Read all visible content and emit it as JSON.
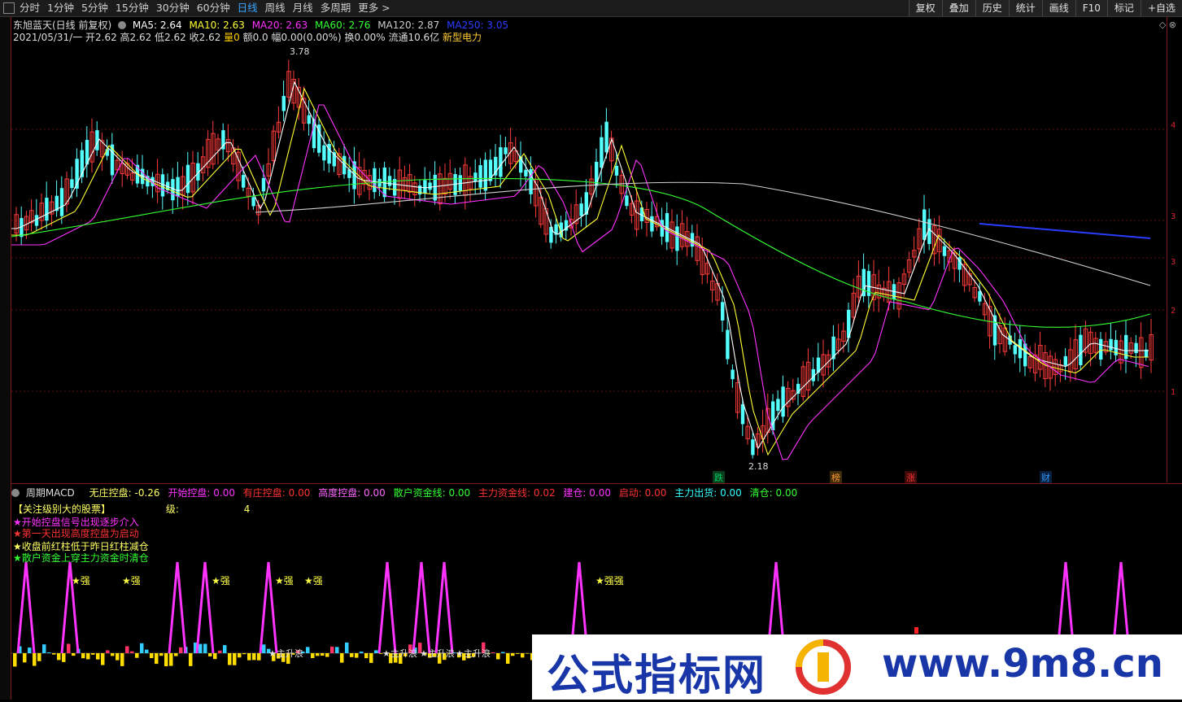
{
  "toolbar": {
    "periods": [
      "分时",
      "1分钟",
      "5分钟",
      "15分钟",
      "30分钟",
      "60分钟",
      "日线",
      "周线",
      "月线",
      "多周期",
      "更多 >"
    ],
    "active_period": "日线",
    "tools": [
      "复权",
      "叠加",
      "历史",
      "统计",
      "画线",
      "F10",
      "标记",
      "+自选"
    ]
  },
  "stock": {
    "title": "东旭蓝天(日线 前复权)",
    "ma": [
      {
        "label": "MA5: 2.64",
        "color": "#ffffff"
      },
      {
        "label": "MA10: 2.63",
        "color": "#ffff33"
      },
      {
        "label": "MA20: 2.63",
        "color": "#ff33ff"
      },
      {
        "label": "MA60: 2.76",
        "color": "#33ff33"
      },
      {
        "label": "MA120: 2.87",
        "color": "#cccccc"
      },
      {
        "label": "MA250: 3.05",
        "color": "#2a3cff"
      }
    ],
    "quote_line": "2021/05/31/一 开2.62 高2.62 低2.62 收2.62 ",
    "quote_vol": "量0",
    "quote_rest": " 额0.0 幅0.00(0.00%) 换0.00% 流通10.6亿 ",
    "quote_extra": "新型电力",
    "high_mark": "3.78",
    "low_mark": "2.18"
  },
  "axis": {
    "ticks": [
      "4",
      "3",
      "2",
      "3",
      "1"
    ]
  },
  "markers": [
    {
      "text": "跌",
      "color": "#00cc66"
    },
    {
      "text": "榜",
      "color": "#ff9933"
    },
    {
      "text": "涨",
      "color": "#ff3333"
    },
    {
      "text": "财",
      "color": "#3399ff"
    }
  ],
  "indicator": {
    "name": "周期MACD",
    "items": [
      {
        "label": "无庄控盘: -0.26",
        "color": "#ffff66"
      },
      {
        "label": "开始控盘: 0.00",
        "color": "#ff33ff"
      },
      {
        "label": "有庄控盘: 0.00",
        "color": "#ff3333"
      },
      {
        "label": "高度控盘: 0.00",
        "color": "#ff66ff"
      },
      {
        "label": "散户资金线: 0.00",
        "color": "#33ff33"
      },
      {
        "label": "主力资金线: 0.02",
        "color": "#ff3333"
      },
      {
        "label": "建仓: 0.00",
        "color": "#ff33ff"
      },
      {
        "label": "启动: 0.00",
        "color": "#ff3333"
      },
      {
        "label": "主力出货: 0.00",
        "color": "#33ffff"
      },
      {
        "label": "清仓: 0.00",
        "color": "#33ff33"
      }
    ],
    "note_title": "【关注级别大的股票】",
    "note_level_label": "级:",
    "note_level_value": "4",
    "notes": [
      {
        "text": "★开始控盘信号出现逐步介入",
        "color": "#ff33ff"
      },
      {
        "text": "★第一天出现高度控盘为启动",
        "color": "#ff3333"
      },
      {
        "text": "★收盘前红柱低于昨日红柱减仓",
        "color": "#ffff66"
      },
      {
        "text": "★散户资金上穿主力资金时清仓",
        "color": "#33ff33"
      }
    ],
    "strong_labels": [
      "★强",
      "★强",
      "★强",
      "★强",
      "★强",
      "★强强"
    ],
    "rise_labels": [
      "★主升浪",
      "★主升浪",
      "★主升浪",
      "★主升浪"
    ]
  },
  "watermark": {
    "brand": "公式指标网",
    "url": "www.9m8.cn"
  }
}
